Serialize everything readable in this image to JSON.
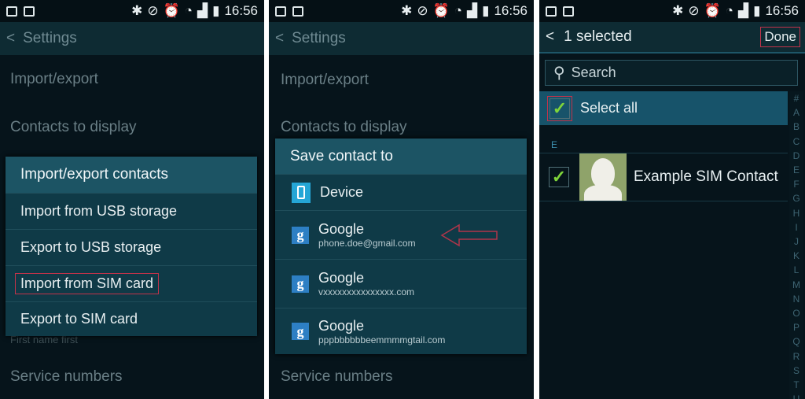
{
  "status_bar": {
    "time": "16:56"
  },
  "panel1": {
    "header": {
      "back_label": "Settings"
    },
    "items": [
      "Import/export",
      "Contacts to display",
      "First name first",
      "Service numbers"
    ],
    "dialog": {
      "title": "Import/export contacts",
      "options": [
        "Import from USB storage",
        "Export to USB storage",
        "Import from SIM card",
        "Export to SIM card"
      ]
    }
  },
  "panel2": {
    "header": {
      "back_label": "Settings"
    },
    "items": [
      "Import/export",
      "Contacts to display",
      "Service numbers"
    ],
    "dialog": {
      "title": "Save contact to",
      "device_label": "Device",
      "accounts": [
        {
          "name": "Google",
          "email": "phone.doe@gmail.com"
        },
        {
          "name": "Google",
          "email": "vxxxxxxxxxxxxxxx.com"
        },
        {
          "name": "Google",
          "email": "pppbbbbbbeemmmmgtail.com"
        }
      ]
    }
  },
  "panel3": {
    "header": {
      "selected_label": "1 selected",
      "done_label": "Done"
    },
    "search": {
      "placeholder": "Search"
    },
    "select_all_label": "Select all",
    "section_letter": "E",
    "contacts": [
      {
        "name": "Example SIM Contact",
        "checked": true
      }
    ],
    "index_letters": [
      "#",
      "A",
      "B",
      "C",
      "D",
      "E",
      "F",
      "G",
      "H",
      "I",
      "J",
      "K",
      "L",
      "M",
      "N",
      "O",
      "P",
      "Q",
      "R",
      "S",
      "T",
      "U"
    ]
  },
  "colors": {
    "accent_check": "#7fd43a",
    "highlight_red": "#c2334a",
    "dialog_title": "#1c5464"
  }
}
